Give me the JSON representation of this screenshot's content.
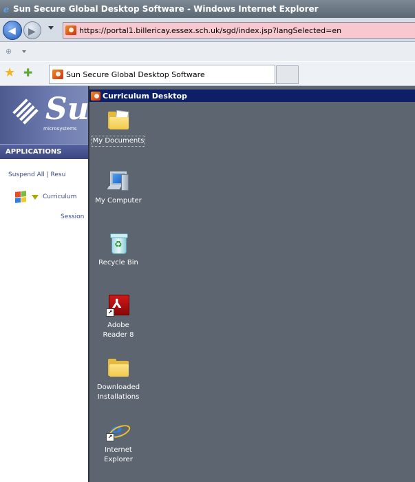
{
  "browser": {
    "window_title": "Sun Secure Global Desktop Software - Windows Internet Explorer",
    "address_url": "https://portal1.billericay.essex.sch.uk/sgd/index.jsp?langSelected=en",
    "tab_title": "Sun Secure Global Desktop Software"
  },
  "sgd_panel": {
    "logo_text": "Sun",
    "logo_subtext": "microsystems",
    "applications_header": "APPLICATIONS",
    "suspend_links": "Suspend All | Resu",
    "app_entry": "Curriculum",
    "session_text": "Session"
  },
  "desktop_window": {
    "title": "Curriculum Desktop",
    "icons": [
      {
        "label": "My Documents",
        "icon": "documents-folder-icon"
      },
      {
        "label": "My Computer",
        "icon": "computer-icon"
      },
      {
        "label": "Recycle Bin",
        "icon": "recycle-bin-icon"
      },
      {
        "label": "Adobe Reader 8",
        "icon": "adobe-reader-icon"
      },
      {
        "label": "Downloaded Installations",
        "icon": "folder-icon"
      },
      {
        "label": "Internet Explorer",
        "icon": "internet-explorer-icon"
      }
    ]
  },
  "colors": {
    "desktop_bg": "#5d6670",
    "desktop_title_bar": "#0d1f66",
    "address_bar_bg": "#f8c8d0",
    "sgd_banner": "#5a67a0"
  }
}
